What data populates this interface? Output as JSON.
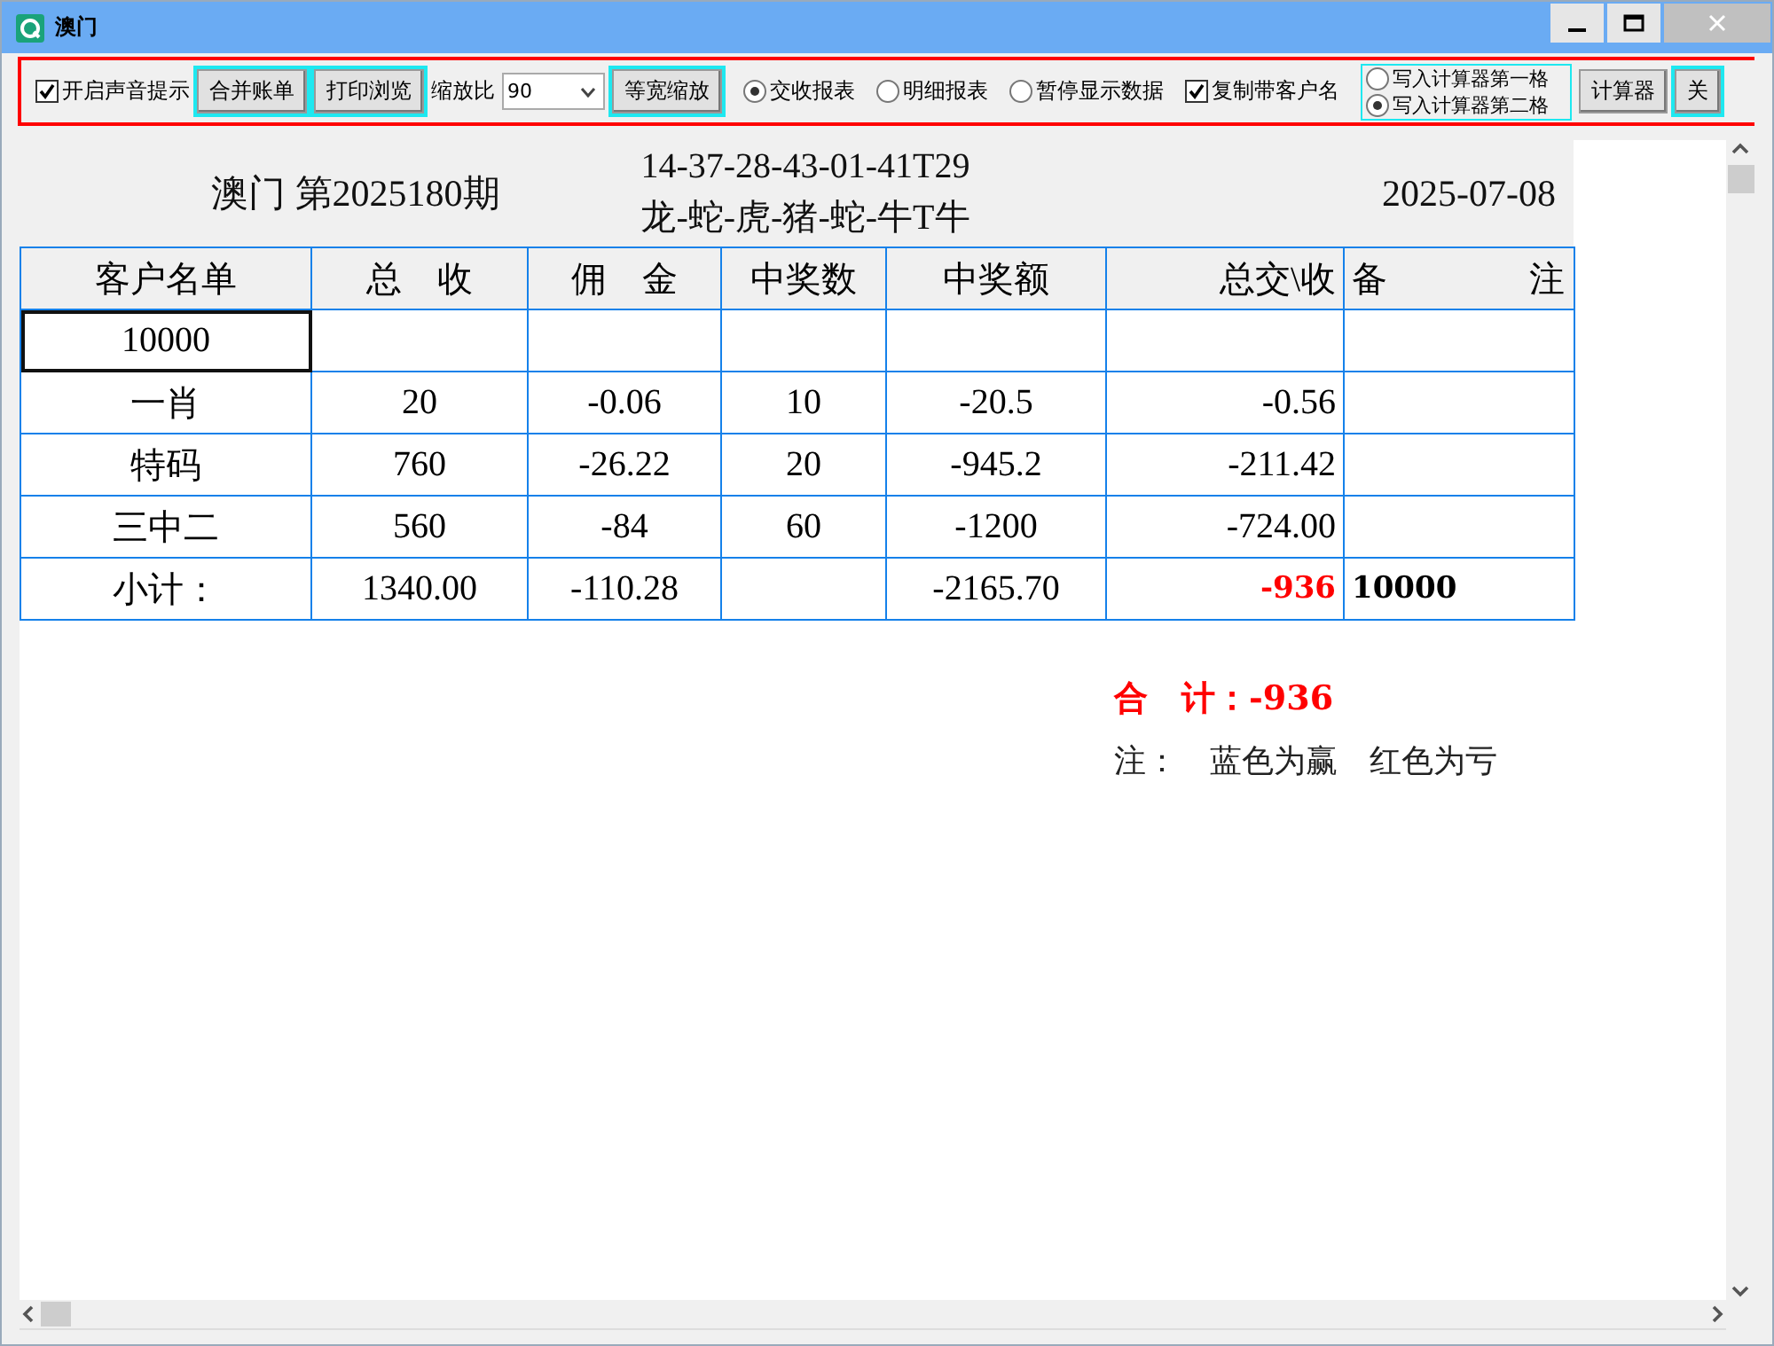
{
  "window": {
    "title": "澳门"
  },
  "toolbar": [
    {
      "kind": "checkbox",
      "label": "开启声音提示",
      "checked": true
    },
    {
      "kind": "button",
      "label": "合并账单",
      "highlighted": true
    },
    {
      "kind": "button",
      "label": "打印浏览",
      "highlighted": true
    },
    {
      "kind": "label",
      "label": "缩放比"
    },
    {
      "kind": "combo",
      "value": "90"
    },
    {
      "kind": "button",
      "label": "等宽缩放",
      "highlighted": true
    },
    {
      "kind": "radio",
      "label": "交收报表",
      "selected": true
    },
    {
      "kind": "radio",
      "label": "明细报表",
      "selected": false
    },
    {
      "kind": "radio",
      "label": "暂停显示数据",
      "selected": false
    },
    {
      "kind": "checkbox",
      "label": "复制带客户名",
      "checked": true
    },
    {
      "kind": "radiogroup",
      "options": [
        {
          "label": "写入计算器第一格",
          "selected": false
        },
        {
          "label": "写入计算器第二格",
          "selected": true
        }
      ]
    },
    {
      "kind": "button",
      "label": "计算器",
      "highlighted": false
    },
    {
      "kind": "button",
      "label": "关",
      "highlighted": true
    }
  ],
  "report": {
    "title": "澳门 第2025180期",
    "numbers": [
      "14-37-28-43-01-41T29",
      "龙-蛇-虎-猪-蛇-牛T牛"
    ],
    "date": "2025-07-08"
  },
  "table": {
    "columns": [
      "客户名单",
      "总　收",
      "佣　金",
      "中奖数",
      "中奖额",
      "总交\\收",
      "备　　　　注"
    ],
    "rows": [
      {
        "cells": [
          {
            "text": "10000",
            "focused": true
          },
          {
            "text": ""
          },
          {
            "text": ""
          },
          {
            "text": ""
          },
          {
            "text": ""
          },
          {
            "text": ""
          },
          {
            "text": ""
          }
        ]
      },
      {
        "cells": [
          {
            "text": "一肖"
          },
          {
            "text": "20"
          },
          {
            "text": "-0.06"
          },
          {
            "text": "10"
          },
          {
            "text": "-20.5"
          },
          {
            "text": "-0.56"
          },
          {
            "text": ""
          }
        ]
      },
      {
        "cells": [
          {
            "text": "特码"
          },
          {
            "text": "760"
          },
          {
            "text": "-26.22"
          },
          {
            "text": "20"
          },
          {
            "text": "-945.2"
          },
          {
            "text": "-211.42"
          },
          {
            "text": ""
          }
        ]
      },
      {
        "cells": [
          {
            "text": "三中二"
          },
          {
            "text": "560"
          },
          {
            "text": "-84"
          },
          {
            "text": "60"
          },
          {
            "text": "-1200"
          },
          {
            "text": "-724.00"
          },
          {
            "text": ""
          }
        ]
      },
      {
        "cells": [
          {
            "text": "小计："
          },
          {
            "text": "1340.00"
          },
          {
            "text": "-110.28"
          },
          {
            "text": ""
          },
          {
            "text": "-2165.70"
          },
          {
            "text": "-936",
            "color": "#ff0000",
            "bold": true
          },
          {
            "text": "10000",
            "bold": true
          }
        ]
      }
    ]
  },
  "total": "合　计：-936",
  "note": "注：　蓝色为赢　红色为亏"
}
